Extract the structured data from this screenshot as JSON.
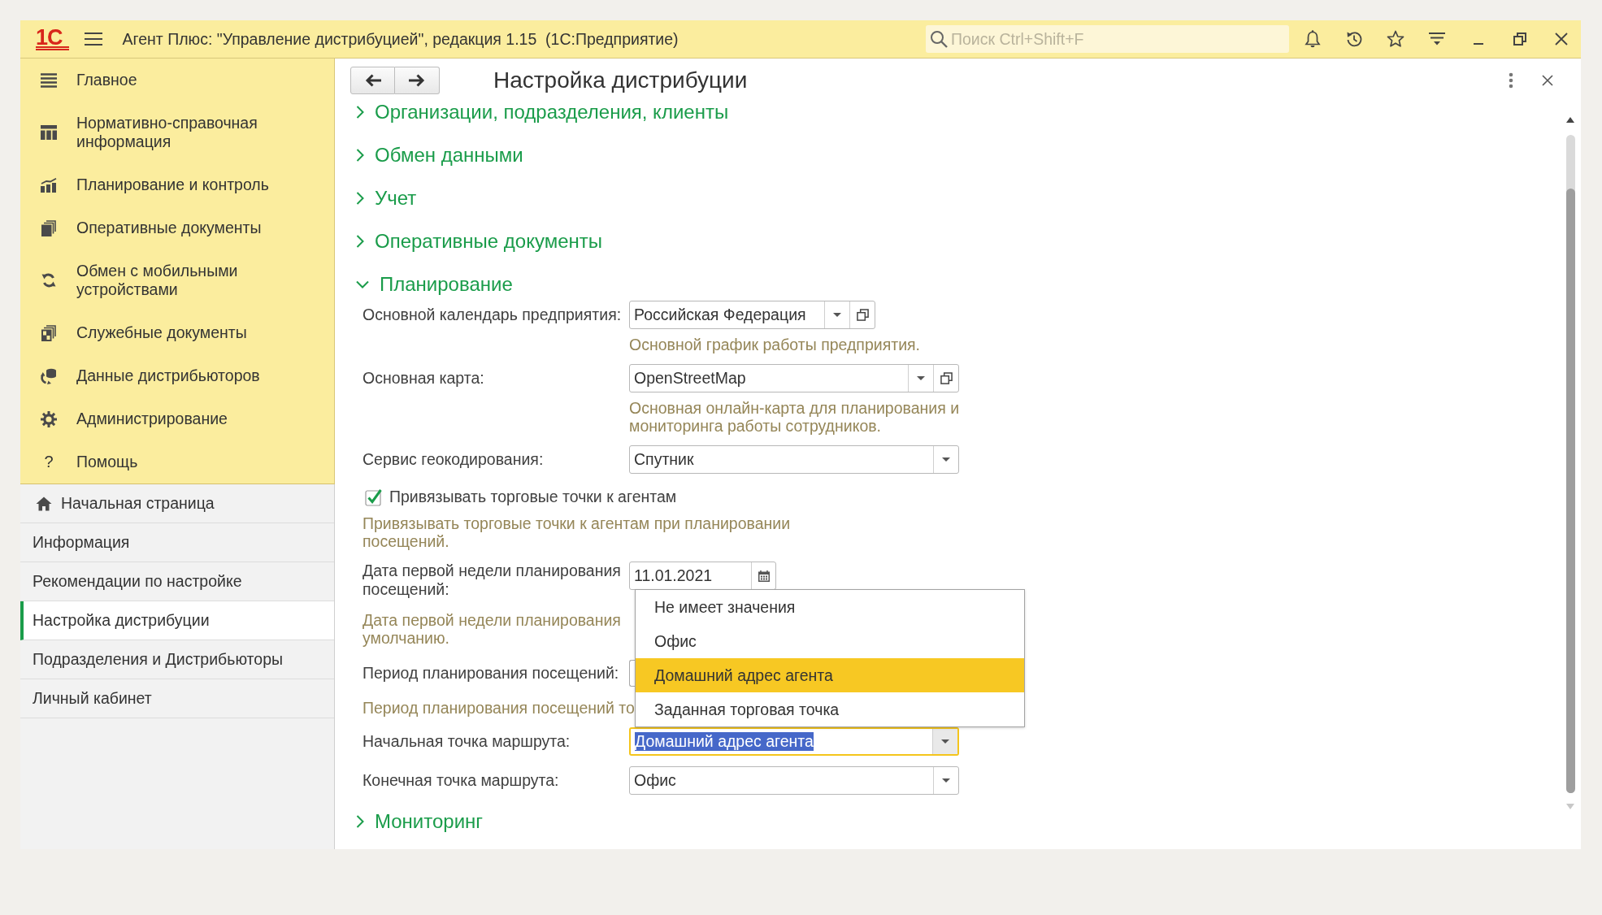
{
  "app": {
    "logo": "1С",
    "title": "Агент Плюс: \"Управление дистрибуцией\", редакция 1.15  (1С:Предприятие)",
    "search": {
      "placeholder": "Поиск Ctrl+Shift+F"
    }
  },
  "sections": [
    {
      "label": "Главное"
    },
    {
      "label": "Нормативно-справочная информация"
    },
    {
      "label": "Планирование и контроль"
    },
    {
      "label": "Оперативные документы"
    },
    {
      "label": "Обмен с мобильными устройствами"
    },
    {
      "label": "Служебные документы"
    },
    {
      "label": "Данные дистрибьюторов"
    },
    {
      "label": "Администрирование"
    },
    {
      "label": "Помощь",
      "glyph": "?"
    }
  ],
  "nav": [
    {
      "label": "Начальная страница",
      "kind": "home",
      "selected": false
    },
    {
      "label": "Информация",
      "kind": "page",
      "selected": false
    },
    {
      "label": "Рекомендации по настройке",
      "kind": "page",
      "selected": false
    },
    {
      "label": "Настройка дистрибуции",
      "kind": "page",
      "selected": true
    },
    {
      "label": "Подразделения и Дистрибьюторы",
      "kind": "page",
      "selected": false
    },
    {
      "label": "Личный кабинет",
      "kind": "page",
      "selected": false
    }
  ],
  "form": {
    "title": "Настройка дистрибуции",
    "groups": [
      {
        "title": "Организации, подразделения, клиенты",
        "expanded": false
      },
      {
        "title": "Обмен данными",
        "expanded": false
      },
      {
        "title": "Учет",
        "expanded": false
      },
      {
        "title": "Оперативные документы",
        "expanded": false
      },
      {
        "title": "Планирование",
        "expanded": true,
        "fields": [
          {
            "kind": "select",
            "label": "Основной календарь предприятия:",
            "value": "Российская Федерация",
            "open_button": true,
            "focused": false,
            "hint": "Основной график работы предприятия."
          },
          {
            "kind": "select",
            "label": "Основная карта:",
            "value": "OpenStreetMap",
            "open_button": true,
            "focused": false,
            "hint": "Основная онлайн-карта для планирования и мониторинга работы сотрудников."
          },
          {
            "kind": "select",
            "label": "Сервис геокодирования:",
            "value": "Спутник",
            "open_button": false,
            "focused": false
          },
          {
            "kind": "checkbox",
            "label": "Привязывать торговые точки к агентам",
            "checked": true,
            "hint": "Привязывать торговые точки к агентам при планировании посещений."
          },
          {
            "kind": "date",
            "label": "Дата первой недели планирования посещений:",
            "value": "11.01.2021",
            "hint_lines": [
              "Дата первой недели планирования",
              "умолчанию."
            ]
          },
          {
            "kind": "covered",
            "label": "Период планирования посещений:",
            "hint": "Период планирования посещений то"
          },
          {
            "kind": "select",
            "label": "Начальная точка маршрута:",
            "value": "Домашний адрес агента",
            "open_button": false,
            "focused": true,
            "options": [
              {
                "label": "Не имеет значения",
                "selected": false
              },
              {
                "label": "Офис",
                "selected": false
              },
              {
                "label": "Домашний адрес агента",
                "selected": true
              },
              {
                "label": "Заданная торговая точка",
                "selected": false
              }
            ]
          },
          {
            "kind": "select",
            "label": "Конечная точка маршрута:",
            "value": "Офис",
            "open_button": false,
            "focused": false
          }
        ]
      },
      {
        "title": "Мониторинг",
        "expanded": false
      }
    ]
  }
}
